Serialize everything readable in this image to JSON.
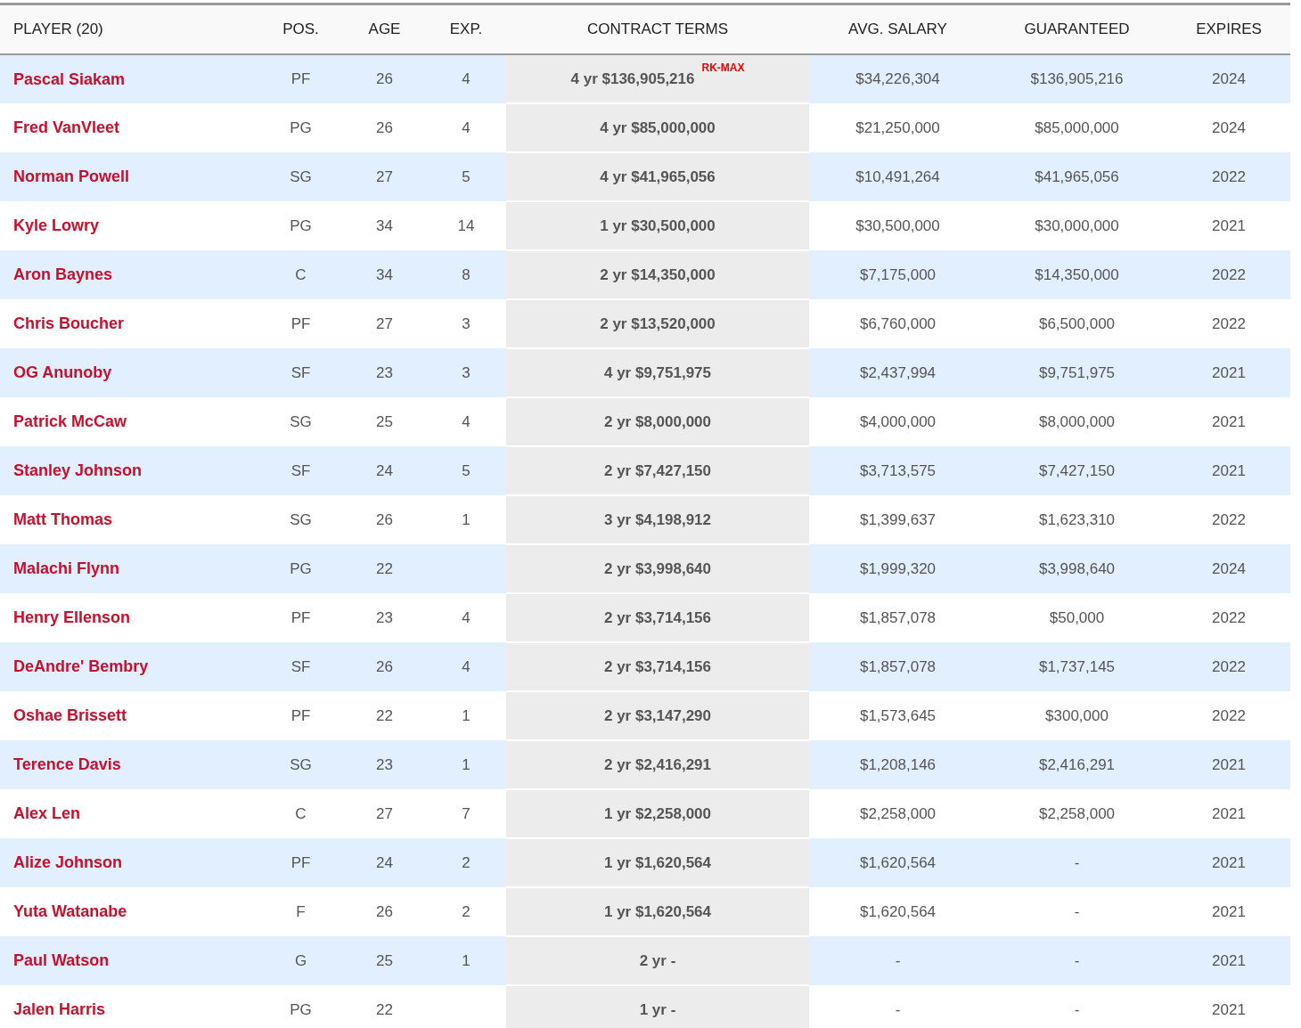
{
  "table": {
    "columns": [
      "PLAYER (20)",
      "POS.",
      "AGE",
      "EXP.",
      "CONTRACT TERMS",
      "AVG. SALARY",
      "GUARANTEED",
      "EXPIRES"
    ],
    "rows": [
      {
        "player": "Pascal Siakam",
        "pos": "PF",
        "age": "26",
        "exp": "4",
        "contract": "4 yr $136,905,216",
        "tag": "RK-MAX",
        "avg_salary": "$34,226,304",
        "guaranteed": "$136,905,216",
        "expires": "2024"
      },
      {
        "player": "Fred VanVleet",
        "pos": "PG",
        "age": "26",
        "exp": "4",
        "contract": "4 yr $85,000,000",
        "avg_salary": "$21,250,000",
        "guaranteed": "$85,000,000",
        "expires": "2024"
      },
      {
        "player": "Norman Powell",
        "pos": "SG",
        "age": "27",
        "exp": "5",
        "contract": "4 yr $41,965,056",
        "avg_salary": "$10,491,264",
        "guaranteed": "$41,965,056",
        "expires": "2022"
      },
      {
        "player": "Kyle Lowry",
        "pos": "PG",
        "age": "34",
        "exp": "14",
        "contract": "1 yr $30,500,000",
        "avg_salary": "$30,500,000",
        "guaranteed": "$30,000,000",
        "expires": "2021"
      },
      {
        "player": "Aron Baynes",
        "pos": "C",
        "age": "34",
        "exp": "8",
        "contract": "2 yr $14,350,000",
        "avg_salary": "$7,175,000",
        "guaranteed": "$14,350,000",
        "expires": "2022"
      },
      {
        "player": "Chris Boucher",
        "pos": "PF",
        "age": "27",
        "exp": "3",
        "contract": "2 yr $13,520,000",
        "avg_salary": "$6,760,000",
        "guaranteed": "$6,500,000",
        "expires": "2022"
      },
      {
        "player": "OG Anunoby",
        "pos": "SF",
        "age": "23",
        "exp": "3",
        "contract": "4 yr $9,751,975",
        "avg_salary": "$2,437,994",
        "guaranteed": "$9,751,975",
        "expires": "2021"
      },
      {
        "player": "Patrick McCaw",
        "pos": "SG",
        "age": "25",
        "exp": "4",
        "contract": "2 yr $8,000,000",
        "avg_salary": "$4,000,000",
        "guaranteed": "$8,000,000",
        "expires": "2021"
      },
      {
        "player": "Stanley Johnson",
        "pos": "SF",
        "age": "24",
        "exp": "5",
        "contract": "2 yr $7,427,150",
        "avg_salary": "$3,713,575",
        "guaranteed": "$7,427,150",
        "expires": "2021"
      },
      {
        "player": "Matt Thomas",
        "pos": "SG",
        "age": "26",
        "exp": "1",
        "contract": "3 yr $4,198,912",
        "avg_salary": "$1,399,637",
        "guaranteed": "$1,623,310",
        "expires": "2022"
      },
      {
        "player": "Malachi Flynn",
        "pos": "PG",
        "age": "22",
        "contract": "2 yr $3,998,640",
        "avg_salary": "$1,999,320",
        "guaranteed": "$3,998,640",
        "expires": "2024"
      },
      {
        "player": "Henry Ellenson",
        "pos": "PF",
        "age": "23",
        "exp": "4",
        "contract": "2 yr $3,714,156",
        "avg_salary": "$1,857,078",
        "guaranteed": "$50,000",
        "expires": "2022"
      },
      {
        "player": "DeAndre' Bembry",
        "pos": "SF",
        "age": "26",
        "exp": "4",
        "contract": "2 yr $3,714,156",
        "avg_salary": "$1,857,078",
        "guaranteed": "$1,737,145",
        "expires": "2022"
      },
      {
        "player": "Oshae Brissett",
        "pos": "PF",
        "age": "22",
        "exp": "1",
        "contract": "2 yr $3,147,290",
        "avg_salary": "$1,573,645",
        "guaranteed": "$300,000",
        "expires": "2022"
      },
      {
        "player": "Terence Davis",
        "pos": "SG",
        "age": "23",
        "exp": "1",
        "contract": "2 yr $2,416,291",
        "avg_salary": "$1,208,146",
        "guaranteed": "$2,416,291",
        "expires": "2021"
      },
      {
        "player": "Alex Len",
        "pos": "C",
        "age": "27",
        "exp": "7",
        "contract": "1 yr $2,258,000",
        "avg_salary": "$2,258,000",
        "guaranteed": "$2,258,000",
        "expires": "2021"
      },
      {
        "player": "Alize Johnson",
        "pos": "PF",
        "age": "24",
        "exp": "2",
        "contract": "1 yr $1,620,564",
        "avg_salary": "$1,620,564",
        "guaranteed": "-",
        "expires": "2021"
      },
      {
        "player": "Yuta Watanabe",
        "pos": "F",
        "age": "26",
        "exp": "2",
        "contract": "1 yr $1,620,564",
        "avg_salary": "$1,620,564",
        "guaranteed": "-",
        "expires": "2021"
      },
      {
        "player": "Paul Watson",
        "pos": "G",
        "age": "25",
        "exp": "1",
        "contract": "2 yr -",
        "avg_salary": "-",
        "guaranteed": "-",
        "expires": "2021"
      },
      {
        "player": "Jalen Harris",
        "pos": "PG",
        "age": "22",
        "contract": "1 yr -",
        "avg_salary": "-",
        "guaranteed": "-",
        "expires": "2021"
      }
    ]
  }
}
